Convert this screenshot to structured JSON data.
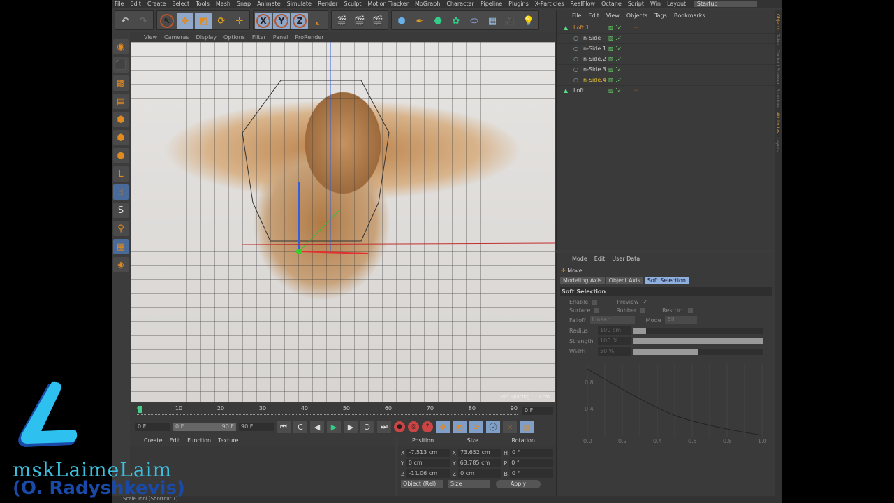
{
  "menu": [
    "File",
    "Edit",
    "Create",
    "Select",
    "Tools",
    "Mesh",
    "Snap",
    "Animate",
    "Simulate",
    "Render",
    "Sculpt",
    "Motion Tracker",
    "MoGraph",
    "Character",
    "Pipeline",
    "Plugins",
    "X-Particles",
    "RealFlow",
    "Octane",
    "Script",
    "Win"
  ],
  "layout": {
    "label": "Layout:",
    "value": "Startup"
  },
  "viewport": {
    "menu": [
      "View",
      "Cameras",
      "Display",
      "Options",
      "Filter",
      "Panel",
      "ProRender"
    ],
    "grid_spacing": "Grid Spacing : 10 cm"
  },
  "timeline": {
    "ticks": [
      "0",
      "10",
      "20",
      "30",
      "40",
      "50",
      "60",
      "70",
      "80",
      "90"
    ],
    "current": "0 F",
    "start": "0 F",
    "range_start": "0 F",
    "range_end": "90 F",
    "end": "90 F"
  },
  "material": {
    "menu": [
      "Create",
      "Edit",
      "Function",
      "Texture"
    ]
  },
  "coords": {
    "headers": [
      "Position",
      "Size",
      "Rotation"
    ],
    "rows": [
      {
        "a": "X",
        "pos": "-7.513 cm",
        "b": "X",
        "size": "73.652 cm",
        "c": "H",
        "rot": "0 °"
      },
      {
        "a": "Y",
        "pos": "0 cm",
        "b": "Y",
        "size": "63.785 cm",
        "c": "P",
        "rot": "0 °"
      },
      {
        "a": "Z",
        "pos": "-11.06 cm",
        "b": "Z",
        "size": "0 cm",
        "c": "B",
        "rot": "0 °"
      }
    ],
    "mode": "Object (Rel)",
    "size_mode": "Size",
    "apply": "Apply"
  },
  "objects": {
    "menu": [
      "File",
      "Edit",
      "View",
      "Objects",
      "Tags",
      "Bookmarks"
    ],
    "items": [
      {
        "name": "Loft.1",
        "color": "#d08a3a",
        "indent": 0
      },
      {
        "name": "n-Side",
        "color": "#cccccc",
        "indent": 1
      },
      {
        "name": "n-Side.1",
        "color": "#cccccc",
        "indent": 1
      },
      {
        "name": "n-Side.2",
        "color": "#cccccc",
        "indent": 1
      },
      {
        "name": "n-Side.3",
        "color": "#cccccc",
        "indent": 1
      },
      {
        "name": "n-Side.4",
        "color": "#e8c030",
        "indent": 1
      },
      {
        "name": "Loft",
        "color": "#cccccc",
        "indent": 0
      }
    ]
  },
  "attributes": {
    "menu": [
      "Mode",
      "Edit",
      "User Data"
    ],
    "tool": "Move",
    "tabs": [
      "Modeling Axis",
      "Object Axis",
      "Soft Selection"
    ],
    "section": "Soft Selection",
    "enable": "Enable",
    "preview": "Preview",
    "surface": "Surface",
    "rubber": "Rubber",
    "restrict": "Restrict",
    "falloff": "Falloff",
    "falloff_value": "Linear",
    "mode": "Mode",
    "mode_value": "All",
    "radius": "Radius",
    "radius_value": "100 cm",
    "strength": "Strength",
    "strength_value": "100 %",
    "width": "Width..",
    "width_value": "50 %",
    "curve_y": [
      "0.8",
      "0.4"
    ],
    "curve_x": [
      "0.0",
      "0.2",
      "0.4",
      "0.6",
      "0.8",
      "1.0"
    ]
  },
  "side_tabs": [
    "Objects",
    "Takes",
    "Content Browser",
    "Structure",
    "Attributes",
    "Layers"
  ],
  "status": "Scale Tool [Shortcut T]",
  "watermark": {
    "letter": "L",
    "name": "mskLaimeLaim",
    "sub": "(O. Radyshkevis)"
  }
}
